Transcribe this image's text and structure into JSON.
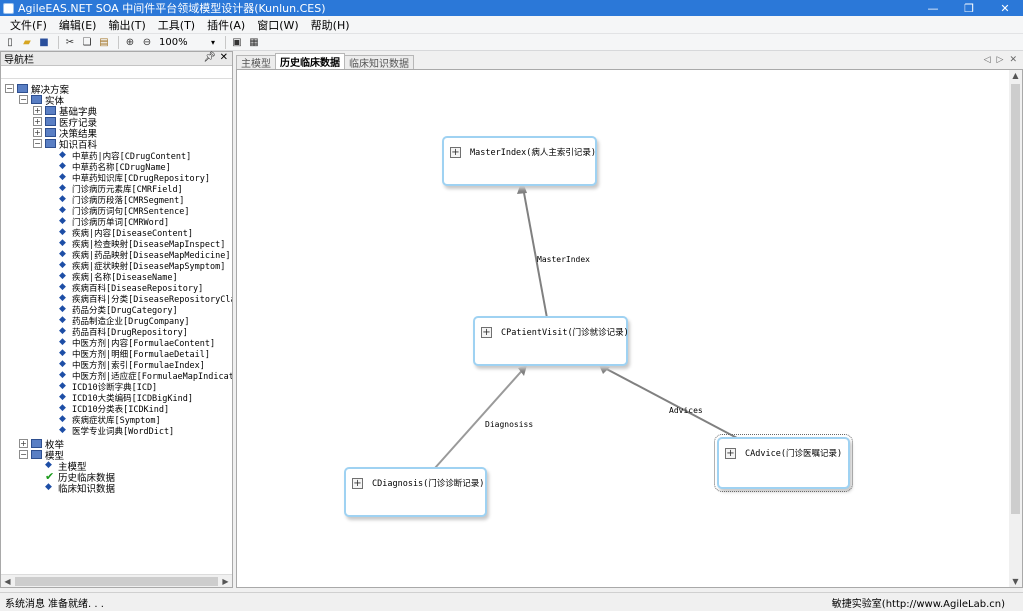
{
  "window": {
    "title": "AgileEAS.NET SOA 中间件平台领域模型设计器(Kunlun.CES)",
    "controls": [
      "—",
      "❐",
      "✕"
    ]
  },
  "menu": [
    "文件(F)",
    "编辑(E)",
    "输出(T)",
    "工具(T)",
    "插件(A)",
    "窗口(W)",
    "帮助(H)"
  ],
  "toolbar": {
    "zoom": "100%"
  },
  "nav": {
    "title": "导航栏",
    "root": "解决方案",
    "entity_folder": "实体",
    "folders": [
      "基础字典",
      "医疗记录",
      "决策结果",
      "知识百科"
    ],
    "knowledge_items": [
      "中草药|内容[CDrugContent]",
      "中草药名称[CDrugName]",
      "中草药知识库[CDrugRepository]",
      "门诊病历元素库[CMRField]",
      "门诊病历段落[CMRSegment]",
      "门诊病历词句[CMRSentence]",
      "门诊病历单词[CMRWord]",
      "疾病|内容[DiseaseContent]",
      "疾病|检查映射[DiseaseMapInspect]",
      "疾病|药品映射[DiseaseMapMedicine]",
      "疾病|症状映射[DiseaseMapSymptom]",
      "疾病|名称[DiseaseName]",
      "疾病百科[DiseaseRepository]",
      "疾病百科|分类[DiseaseRepositoryClass]",
      "药品分类[DrugCategory]",
      "药品制造企业[DrugCompany]",
      "药品百科[DrugRepository]",
      "中医方剂|内容[FormulaeContent]",
      "中医方剂|明细[FormulaeDetail]",
      "中医方剂|索引[FormulaeIndex]",
      "中医方剂|适应症[FormulaeMapIndication]",
      "ICD10诊断字典[ICD]",
      "ICD10大类编码[ICDBigKind]",
      "ICD10分类表[ICDKind]",
      "疾病症状库[Symptom]",
      "医学专业词典[WordDict]"
    ],
    "enum_folder": "枚举",
    "model_folder": "模型",
    "models": [
      "主模型",
      "历史临床数据",
      "临床知识数据"
    ]
  },
  "tabs": [
    "主模型",
    "历史临床数据",
    "临床知识数据"
  ],
  "active_tab": 1,
  "diagram": {
    "entities": {
      "masterindex": "MasterIndex(病人主索引记录)",
      "patientvisit": "CPatientVisit(门诊就诊记录)",
      "diagnosis": "CDiagnosis(门诊诊断记录)",
      "advice": "CAdvice(门诊医嘱记录)"
    },
    "connectors": {
      "masterindex": "MasterIndex",
      "diagnosis": "Diagnosiss",
      "advices": "Advices"
    }
  },
  "status": {
    "label": "系统消息",
    "message": "准备就绪. . .",
    "right": "敏捷实验室(http://www.AgileLab.cn)"
  },
  "colors": {
    "titlebar": "#2b78d8",
    "entity_border": "#9fd2f2",
    "connector": "#808080"
  }
}
